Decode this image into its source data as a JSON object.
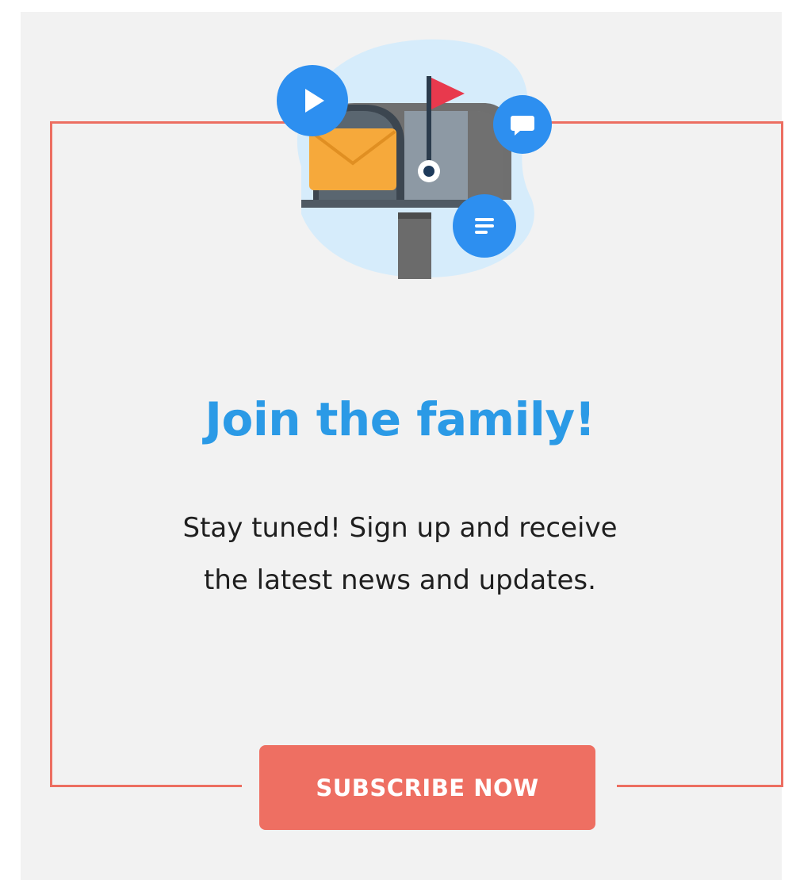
{
  "signup": {
    "title": "Join the family!",
    "body_line_1": "Stay tuned!  Sign up and receive",
    "body_line_2": "the latest news and updates.",
    "button_label": "SUBSCRIBE NOW"
  },
  "icons": {
    "hero": "mailbox-illustration",
    "play": "play-icon",
    "chat": "chat-bubble-icon",
    "doc": "document-lines-icon",
    "envelope": "envelope-icon",
    "flag": "flag-icon"
  },
  "colors": {
    "background": "#f2f2f2",
    "accent_frame": "#ec6e61",
    "button": "#ee6f62",
    "title": "#2b9ae6",
    "body_text": "#1f1f1f",
    "icon_blue": "#2d8ff0"
  }
}
